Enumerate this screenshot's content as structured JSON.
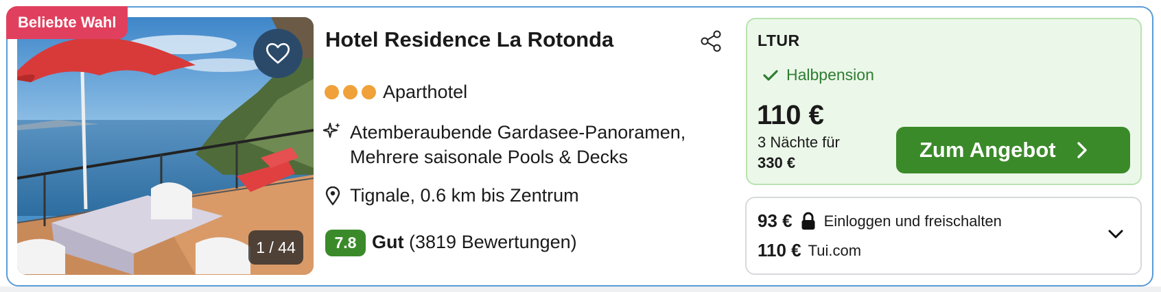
{
  "hotel": {
    "badge": "Beliebte Wahl",
    "name": "Hotel Residence La Rotonda",
    "photo_counter": "1 / 44",
    "stars": 3,
    "type": "Aparthotel",
    "features": [
      "Atemberaubende Gardasee-Panoramen,",
      "Mehrere saisonale Pools & Decks"
    ],
    "location": "Tignale, 0.6 km bis Zentrum",
    "score": "7.8",
    "rating_label": "Gut",
    "reviews": "(3819 Bewertungen)"
  },
  "offer": {
    "provider": "LTUR",
    "board": "Halbpension",
    "price": "110 €",
    "nights": "3 Nächte für",
    "total": "330 €",
    "cta": "Zum Angebot"
  },
  "alternatives": {
    "locked_price": "93 €",
    "locked_text": "Einloggen und freischalten",
    "price": "110 €",
    "provider": "Tui.com"
  },
  "colors": {
    "badge": "#e0405e",
    "accent_green": "#3b8a2a",
    "offer_bg": "#ebf7e8",
    "star": "#f0a13a",
    "card_border": "#5a9bd6"
  },
  "icons": [
    "heart-icon",
    "share-icon",
    "sparkle-icon",
    "map-pin-icon",
    "check-icon",
    "chevron-right-icon",
    "lock-icon",
    "chevron-down-icon"
  ]
}
